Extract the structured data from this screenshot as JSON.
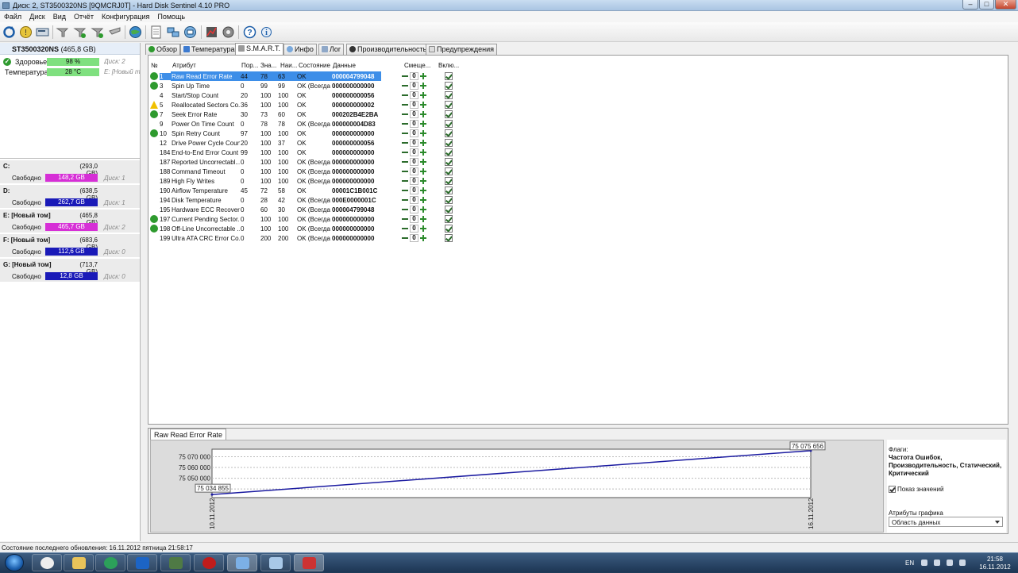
{
  "window": {
    "title": "Диск: 2, ST3500320NS [9QMCRJ0T] - Hard Disk Sentinel 4.10 PRO",
    "controls": [
      "–",
      "□",
      "✕"
    ]
  },
  "menu": [
    "Файл",
    "Диск",
    "Вид",
    "Отчёт",
    "Конфигурация",
    "Помощь"
  ],
  "toolbar_icons": [
    "refresh-icon",
    "warning-disk-icon",
    "disk-icon",
    "tool-icon",
    "tool2-icon",
    "tool3-icon",
    "tool4-icon",
    "globe-icon",
    "report-icon",
    "network-icon",
    "network2-icon",
    "chart-icon",
    "settings-icon",
    "help-icon",
    "info-icon"
  ],
  "left": {
    "disk_name": "ST3500320NS",
    "disk_size": "(465,8 GB)",
    "health_label": "Здоровье:",
    "health_value": "98 %",
    "health_disk": "Диск: 2",
    "temp_label": "Температура:",
    "temp_value": "28 °C",
    "temp_disk": "E: [Новый том]",
    "free_label": "Свободно",
    "volumes": [
      {
        "name": "C:",
        "size": "(293,0 GB)",
        "free": "148,2 GB",
        "disk": "Диск: 1",
        "color": "#d62fd6"
      },
      {
        "name": "D:",
        "size": "(638,5 GB)",
        "free": "262,7 GB",
        "disk": "Диск: 1",
        "color": "#1a1ab8"
      },
      {
        "name": "E: [Новый том]",
        "size": "(465,8 GB)",
        "free": "465,7 GB",
        "disk": "Диск: 2",
        "color": "#d62fd6"
      },
      {
        "name": "F: [Новый том]",
        "size": "(683,6 GB)",
        "free": "112,6 GB",
        "disk": "Диск: 0",
        "color": "#1a1ab8"
      },
      {
        "name": "G: [Новый том]",
        "size": "(713,7 GB)",
        "free": "12,8 GB",
        "disk": "Диск: 0",
        "color": "#1a1ab8"
      }
    ]
  },
  "tabs": [
    "Обзор",
    "Температура",
    "S.M.A.R.T.",
    "Инфо",
    "Лог",
    "Производительность",
    "Предупреждения"
  ],
  "active_tab": "S.M.A.R.T.",
  "table": {
    "headers": [
      "№",
      "Атрибут",
      "Пор...",
      "Зна...",
      "Наи...",
      "Состояние",
      "Данные",
      "Смеще...",
      "Вклю..."
    ],
    "rows": [
      {
        "no": "1",
        "attr": "Raw Read Error Rate",
        "th": "44",
        "val": "78",
        "wor": "63",
        "st": "OK",
        "data": "000004799048",
        "icon": "ok",
        "selected": true
      },
      {
        "no": "3",
        "attr": "Spin Up Time",
        "th": "0",
        "val": "99",
        "wor": "99",
        "st": "OK (Всегда...",
        "data": "000000000000",
        "icon": "ok"
      },
      {
        "no": "4",
        "attr": "Start/Stop Count",
        "th": "20",
        "val": "100",
        "wor": "100",
        "st": "OK",
        "data": "000000000056",
        "icon": ""
      },
      {
        "no": "5",
        "attr": "Reallocated Sectors Co...",
        "th": "36",
        "val": "100",
        "wor": "100",
        "st": "OK",
        "data": "000000000002",
        "icon": "warn"
      },
      {
        "no": "7",
        "attr": "Seek Error Rate",
        "th": "30",
        "val": "73",
        "wor": "60",
        "st": "OK",
        "data": "000202B4E2BA",
        "icon": "ok"
      },
      {
        "no": "9",
        "attr": "Power On Time Count",
        "th": "0",
        "val": "78",
        "wor": "78",
        "st": "OK (Всегда...",
        "data": "000000004D83",
        "icon": ""
      },
      {
        "no": "10",
        "attr": "Spin Retry Count",
        "th": "97",
        "val": "100",
        "wor": "100",
        "st": "OK",
        "data": "000000000000",
        "icon": "ok"
      },
      {
        "no": "12",
        "attr": "Drive Power Cycle Count",
        "th": "20",
        "val": "100",
        "wor": "37",
        "st": "OK",
        "data": "000000000056",
        "icon": ""
      },
      {
        "no": "184",
        "attr": "End-to-End Error Count",
        "th": "99",
        "val": "100",
        "wor": "100",
        "st": "OK",
        "data": "000000000000",
        "icon": ""
      },
      {
        "no": "187",
        "attr": "Reported Uncorrectabl...",
        "th": "0",
        "val": "100",
        "wor": "100",
        "st": "OK (Всегда...",
        "data": "000000000000",
        "icon": ""
      },
      {
        "no": "188",
        "attr": "Command Timeout",
        "th": "0",
        "val": "100",
        "wor": "100",
        "st": "OK (Всегда...",
        "data": "000000000000",
        "icon": ""
      },
      {
        "no": "189",
        "attr": "High Fly Writes",
        "th": "0",
        "val": "100",
        "wor": "100",
        "st": "OK (Всегда...",
        "data": "000000000000",
        "icon": ""
      },
      {
        "no": "190",
        "attr": "Airflow Temperature",
        "th": "45",
        "val": "72",
        "wor": "58",
        "st": "OK",
        "data": "00001C1B001C",
        "icon": ""
      },
      {
        "no": "194",
        "attr": "Disk Temperature",
        "th": "0",
        "val": "28",
        "wor": "42",
        "st": "OK (Всегда...",
        "data": "000E0000001C",
        "icon": ""
      },
      {
        "no": "195",
        "attr": "Hardware ECC Recovered",
        "th": "0",
        "val": "60",
        "wor": "30",
        "st": "OK (Всегда...",
        "data": "000004799048",
        "icon": ""
      },
      {
        "no": "197",
        "attr": "Current Pending Sector...",
        "th": "0",
        "val": "100",
        "wor": "100",
        "st": "OK (Всегда...",
        "data": "000000000000",
        "icon": "ok"
      },
      {
        "no": "198",
        "attr": "Off-Line Uncorrectable ...",
        "th": "0",
        "val": "100",
        "wor": "100",
        "st": "OK (Всегда...",
        "data": "000000000000",
        "icon": "ok"
      },
      {
        "no": "199",
        "attr": "Ultra ATA CRC Error Co...",
        "th": "0",
        "val": "200",
        "wor": "200",
        "st": "OK (Всегда...",
        "data": "000000000000",
        "icon": ""
      }
    ],
    "offset_value": "0"
  },
  "graph": {
    "tab": "Raw Read Error Rate",
    "flags_title": "Флаги:",
    "flags_value": "Частота Ошибок, Производительность, Статический, Критический",
    "show_values": "Показ значений",
    "attrs_title": "Атрибуты графика",
    "attrs_value": "Область данных"
  },
  "chart_data": {
    "type": "line",
    "x": [
      "10.11.2012",
      "16.11.2012"
    ],
    "series": [
      {
        "values": [
          75034855,
          75075656
        ]
      }
    ],
    "y_ticks": [
      "75 070 000",
      "75 060 000",
      "75 050 000",
      "75 04"
    ],
    "start_label": "75 034 855",
    "end_label": "75 075 656",
    "ylim": [
      75032000,
      75077000
    ]
  },
  "status": "Состояние последнего обновления: 16.11.2012 пятница 21:58:17",
  "taskbar": {
    "lang": "EN",
    "time": "21:58",
    "date": "16.11.2012"
  }
}
